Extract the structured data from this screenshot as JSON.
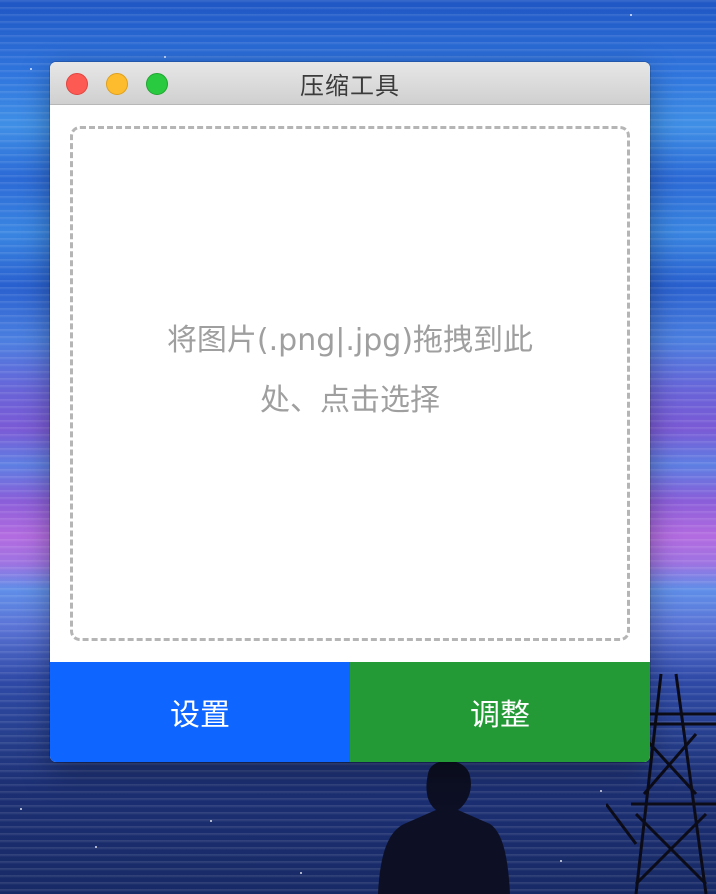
{
  "window": {
    "title": "压缩工具"
  },
  "dropzone": {
    "text": "将图片(.png|.jpg)拖拽到此处、点击选择"
  },
  "buttons": {
    "settings_label": "设置",
    "adjust_label": "调整"
  },
  "colors": {
    "settings_button": "#0f65ff",
    "adjust_button": "#249a37",
    "close_button": "#fd5a54",
    "minimize_button": "#fdbc2e",
    "maximize_button": "#29c940",
    "dropzone_border": "#b5b5b5",
    "dropzone_text": "#9f9f9f"
  }
}
